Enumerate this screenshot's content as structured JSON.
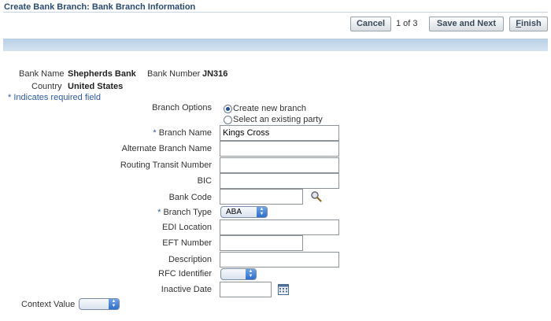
{
  "header": {
    "title": "Create Bank Branch: Bank Branch Information",
    "cancel_label": "Cancel",
    "step_text": "1 of 3",
    "save_next_label": "Save and Next",
    "finish_label_prefix": "F",
    "finish_label_rest": "inish"
  },
  "summary": {
    "bank_name_label": "Bank Name",
    "bank_name_value": "Shepherds Bank",
    "bank_number_label": "Bank Number",
    "bank_number_value": "JN316",
    "country_label": "Country",
    "country_value": "United States",
    "required_note": "* Indicates required field"
  },
  "form": {
    "branch_options_label": "Branch Options",
    "option_create": "Create new branch",
    "option_select": "Select an existing party",
    "required_marker": "* ",
    "branch_name_label": "Branch Name",
    "branch_name_value": "Kings Cross",
    "alternate_branch_name_label": "Alternate Branch Name",
    "routing_transit_number_label": "Routing Transit Number",
    "bic_label": "BIC",
    "bank_code_label": "Bank Code",
    "branch_type_label": "Branch Type",
    "branch_type_value": "ABA",
    "edi_location_label": "EDI Location",
    "eft_number_label": "EFT Number",
    "description_label": "Description",
    "rfc_identifier_label": "RFC Identifier",
    "rfc_identifier_value": "",
    "inactive_date_label": "Inactive Date",
    "context_value_label": "Context Value",
    "context_value_value": ""
  },
  "icons": {
    "search": "search-icon",
    "calendar": "calendar-icon",
    "select_arrows": "updown-arrows-icon"
  },
  "colors": {
    "title": "#2b4a73",
    "band": "#c3d7ec",
    "required": "#2c5b9c",
    "select_arrow": "#2e6fcf"
  }
}
